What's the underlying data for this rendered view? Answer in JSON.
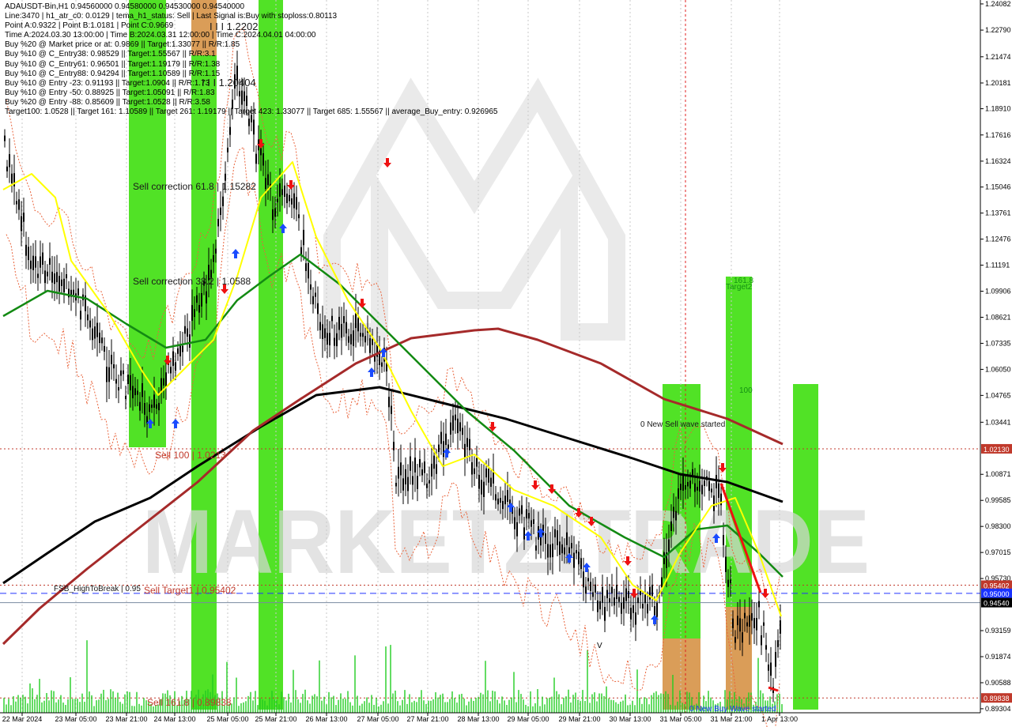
{
  "header": {
    "symbol_line": "ADAUSDT-Bin,H1  0.94560000 0.94580000 0.94530000 0.94540000",
    "info_lines": [
      "Line:3470 | h1_atr_c0: 0.0129 | tema_h1_status: Sell | Last Signal is:Buy with stoploss:0.80113",
      "Point A:0.9322 | Point B:1.0181 | Point C:0.9669",
      "Time A:2024.03.30 13:00:00 | Time B:2024.03.31 12:00:00 | Time C:2024.04.01 04:00:00",
      "Buy %20 @ Market price or at: 0.9869 || Target:1.33077 || R/R:1.85",
      "Buy %10 @ C_Entry38: 0.98529 || Target:1.55567 || R/R:3.1",
      "Buy %10 @ C_Entry61: 0.96501 || Target:1.19179 || R/R:1.38",
      "Buy %10 @ C_Entry88: 0.94294 || Target:1.10589 || R/R:1.15",
      "Buy %10 @ Entry -23: 0.91193 || Target:1.0904 || R/R:1.73",
      "Buy %10 @ Entry -50: 0.88925 || Target:1.05091 || R/R:1.83",
      "Buy %20 @ Entry -88: 0.85609 || Target:1.0528 || R/R:3.58",
      "Target100: 1.0528 || Target 161: 1.10589 || Target 261: 1.19179 || Target 423: 1.33077 || Target 685: 1.55567 || average_Buy_entry: 0.926965"
    ]
  },
  "colors": {
    "background": "#ffffff",
    "green_zone": "#33dd00",
    "orange_zone": "#e9965e",
    "black_ma": "#000000",
    "brown_ma": "#a52a2a",
    "green_ma": "#138a13",
    "yellow_ma": "#ffff00",
    "buy_arrow": "#1a4bff",
    "sell_arrow": "#ee1111",
    "candle": "#000000",
    "volume": "#22cc22",
    "watermark": "#d8d8d8"
  },
  "watermark_text": "MARKETZITRADE",
  "chart_data": {
    "type": "candlestick",
    "symbol": "ADAUSDT-Bin",
    "timeframe": "H1",
    "ylim": [
      0.893,
      1.2408
    ],
    "y_ticks": [
      "1.24082",
      "1.22790",
      "1.21474",
      "1.20181",
      "1.18910",
      "1.17616",
      "1.16324",
      "1.15046",
      "1.13761",
      "1.12476",
      "1.11191",
      "1.09906",
      "1.08621",
      "1.07335",
      "1.06050",
      "1.04765",
      "1.03441",
      "1.00871",
      "0.99585",
      "0.98300",
      "0.97015",
      "0.95730",
      "0.93159",
      "0.91874",
      "0.90588",
      "0.89304"
    ],
    "x_labels": [
      "22 Mar 2024",
      "23 Mar 05:00",
      "23 Mar 21:00",
      "24 Mar 13:00",
      "25 Mar 05:00",
      "25 Mar 21:00",
      "26 Mar 13:00",
      "27 Mar 05:00",
      "27 Mar 21:00",
      "28 Mar 13:00",
      "29 Mar 05:00",
      "29 Mar 21:00",
      "30 Mar 13:00",
      "31 Mar 05:00",
      "31 Mar 21:00",
      "1 Apr 13:00"
    ],
    "price_badges": [
      {
        "value": "1.02130",
        "color": "#c0392b"
      },
      {
        "value": "0.95402",
        "color": "#c0392b"
      },
      {
        "value": "0.95000",
        "color": "#1a33ff"
      },
      {
        "value": "0.94540",
        "color": "#000000"
      },
      {
        "value": "0.89838",
        "color": "#c0392b"
      }
    ],
    "horizontal_levels": [
      {
        "value": 1.0213,
        "style": "dotted",
        "color": "#c0392b"
      },
      {
        "value": 0.95402,
        "style": "dotted",
        "color": "#c0392b"
      },
      {
        "value": 0.95,
        "style": "dashed",
        "color": "#2233ff"
      },
      {
        "value": 0.9454,
        "style": "solid",
        "color": "#7a8aa0"
      },
      {
        "value": 0.89838,
        "style": "dotted",
        "color": "#c0392b"
      }
    ],
    "annotations": [
      {
        "text": "Sell correction 61.8 | 1.15282",
        "color": "#1a1a1a"
      },
      {
        "text": "Sell correction 38.2 | 1.0588",
        "color": "#1a1a1a"
      },
      {
        "text": "Sell 100 | 1.0213",
        "color": "#c0392b"
      },
      {
        "text": "Sell Target1 | 0.95402",
        "color": "#c0392b"
      },
      {
        "text": "Sell 161.8 | 0.89838",
        "color": "#c0392b"
      },
      {
        "text": "FSB_HighToBreak | 0.95",
        "color": "#1a1a1a"
      },
      {
        "text": "0 New Sell wave started",
        "color": "#1a1a1a"
      },
      {
        "text": "0 New Buy Wave started",
        "color": "#1a33ff"
      },
      {
        "text": "I  I  I  1.2202",
        "color": "#1a1a1a"
      },
      {
        "text": "I  I  I  1.20404",
        "color": "#1a1a1a"
      },
      {
        "text": "Target2",
        "color": "#139013"
      },
      {
        "text": "100",
        "color": "#139013"
      },
      {
        "text": "161.8",
        "color": "#139013"
      },
      {
        "text": "V",
        "color": "#000000"
      }
    ]
  }
}
